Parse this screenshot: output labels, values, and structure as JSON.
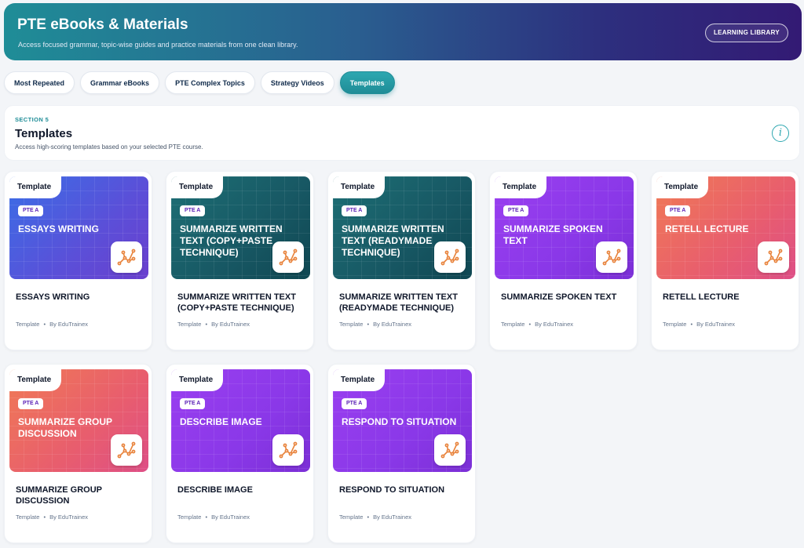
{
  "header": {
    "title": "PTE eBooks & Materials",
    "subtitle": "Access focused grammar, topic-wise guides and practice materials from one clean library.",
    "library_button": "LEARNING LIBRARY"
  },
  "tabs": [
    {
      "label": "Most Repeated",
      "active": false
    },
    {
      "label": "Grammar eBooks",
      "active": false
    },
    {
      "label": "PTE Complex Topics",
      "active": false
    },
    {
      "label": "Strategy Videos",
      "active": false
    },
    {
      "label": "Templates",
      "active": true
    }
  ],
  "section": {
    "kicker": "SECTION 5",
    "title": "Templates",
    "description": "Access high-scoring templates based on your selected PTE course.",
    "info_icon": "i"
  },
  "card_common": {
    "tag": "Template",
    "course": "PTE A",
    "meta_type": "Template",
    "meta_dot": "•",
    "meta_author": "By EduTrainex",
    "icon": "template-logo-icon",
    "logo_color": "#e8823a"
  },
  "colors": {
    "accent": "#1f8d97",
    "blue": "#3a6ee6",
    "teal": "#1d6f75",
    "purple": "#9a3ff0",
    "coral": "#f07a55"
  },
  "cards": [
    {
      "banner_title": "ESSAYS WRITING",
      "title": "ESSAYS WRITING",
      "theme": "blue"
    },
    {
      "banner_title": "SUMMARIZE WRITTEN TEXT (COPY+PASTE TECHNIQUE)",
      "title": "SUMMARIZE WRITTEN TEXT (COPY+PASTE TECHNIQUE)",
      "theme": "teal"
    },
    {
      "banner_title": "SUMMARIZE WRITTEN TEXT (READYMADE TECHNIQUE)",
      "title": "SUMMARIZE WRITTEN TEXT (READYMADE TECHNIQUE)",
      "theme": "teal"
    },
    {
      "banner_title": "SUMMARIZE SPOKEN TEXT",
      "title": "SUMMARIZE SPOKEN TEXT",
      "theme": "purple"
    },
    {
      "banner_title": "RETELL LECTURE",
      "title": "RETELL LECTURE",
      "theme": "coral"
    },
    {
      "banner_title": "SUMMARIZE GROUP DISCUSSION",
      "title": "SUMMARIZE GROUP DISCUSSION",
      "theme": "coral"
    },
    {
      "banner_title": "DESCRIBE IMAGE",
      "title": "DESCRIBE IMAGE",
      "theme": "purple"
    },
    {
      "banner_title": "RESPOND TO SITUATION",
      "title": "RESPOND TO SITUATION",
      "theme": "purple"
    }
  ]
}
